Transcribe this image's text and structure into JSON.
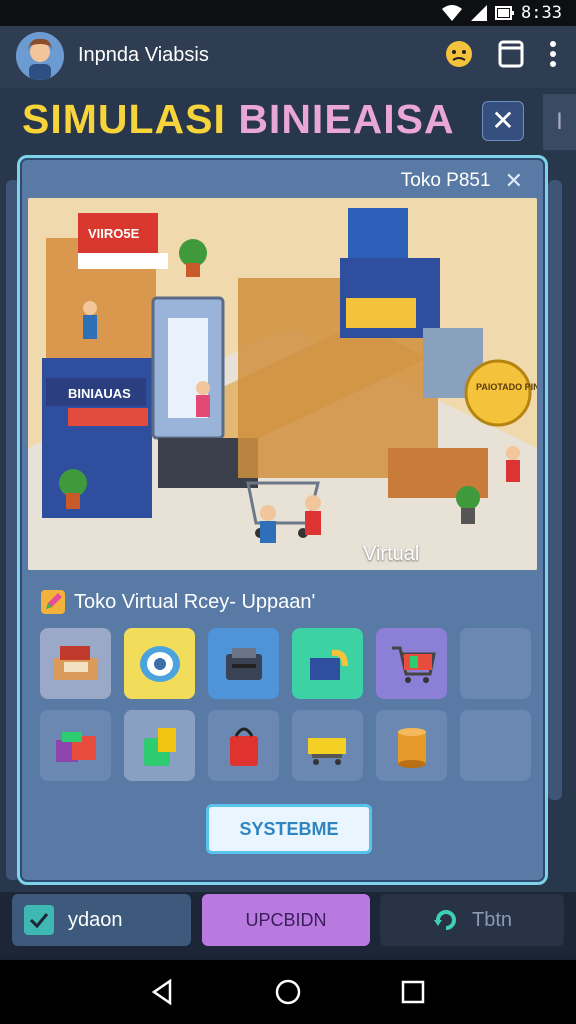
{
  "status": {
    "time": "8:33"
  },
  "app": {
    "title": "Inpnda Viabsis",
    "emoji_icon": "neutral-face-icon",
    "window_icon": "window-icon",
    "menu_icon": "kebab-menu-icon"
  },
  "game": {
    "title_part1": "SIMULASI",
    "title_part2": "BINIEAISA",
    "close_symbol": "✕",
    "side_tab": "I"
  },
  "dialog": {
    "header": "Toko P851",
    "close_symbol": "✕",
    "scene_label": "Virtual",
    "scene_signs": {
      "top_stall": "VIIRO5E",
      "left_stall": "BINIAUAS",
      "round_sign": "PAIOTADO PINSIA"
    },
    "section_title": "Toko Virtual Rcey- Uppaan'",
    "section_icon": "pencil-icon",
    "items": [
      {
        "icon": "register-icon",
        "bg": "#9aa9c7"
      },
      {
        "icon": "tape-roll-icon",
        "bg": "#f2dd5a"
      },
      {
        "icon": "printer-icon",
        "bg": "#4f94d9"
      },
      {
        "icon": "scanner-icon",
        "bg": "#3dd2a3"
      },
      {
        "icon": "shopping-cart-icon",
        "bg": "#8b7fd6"
      },
      {
        "icon": "empty-slot",
        "bg": "#6a88b2"
      },
      {
        "icon": "gift-box-icon",
        "bg": "#6a88b2"
      },
      {
        "icon": "shopping-bag-icon",
        "bg": "#8aa0c2"
      },
      {
        "icon": "red-bag-icon",
        "bg": "#6a88b2"
      },
      {
        "icon": "cart-trolley-icon",
        "bg": "#6a88b2"
      },
      {
        "icon": "cylinder-box-icon",
        "bg": "#6a88b2"
      },
      {
        "icon": "empty-slot",
        "bg": "#6a88b2"
      }
    ],
    "primary_button": "SYSTEBME"
  },
  "bottom": {
    "left_label": "ydaon",
    "mid_label": "UPCBIDN",
    "right_label": "Tbtn"
  },
  "colors": {
    "accent_yellow": "#f7d43a",
    "accent_pink": "#e9a7d6",
    "dialog_border": "#7dd3ea",
    "dialog_bg": "#5a7aa6"
  }
}
